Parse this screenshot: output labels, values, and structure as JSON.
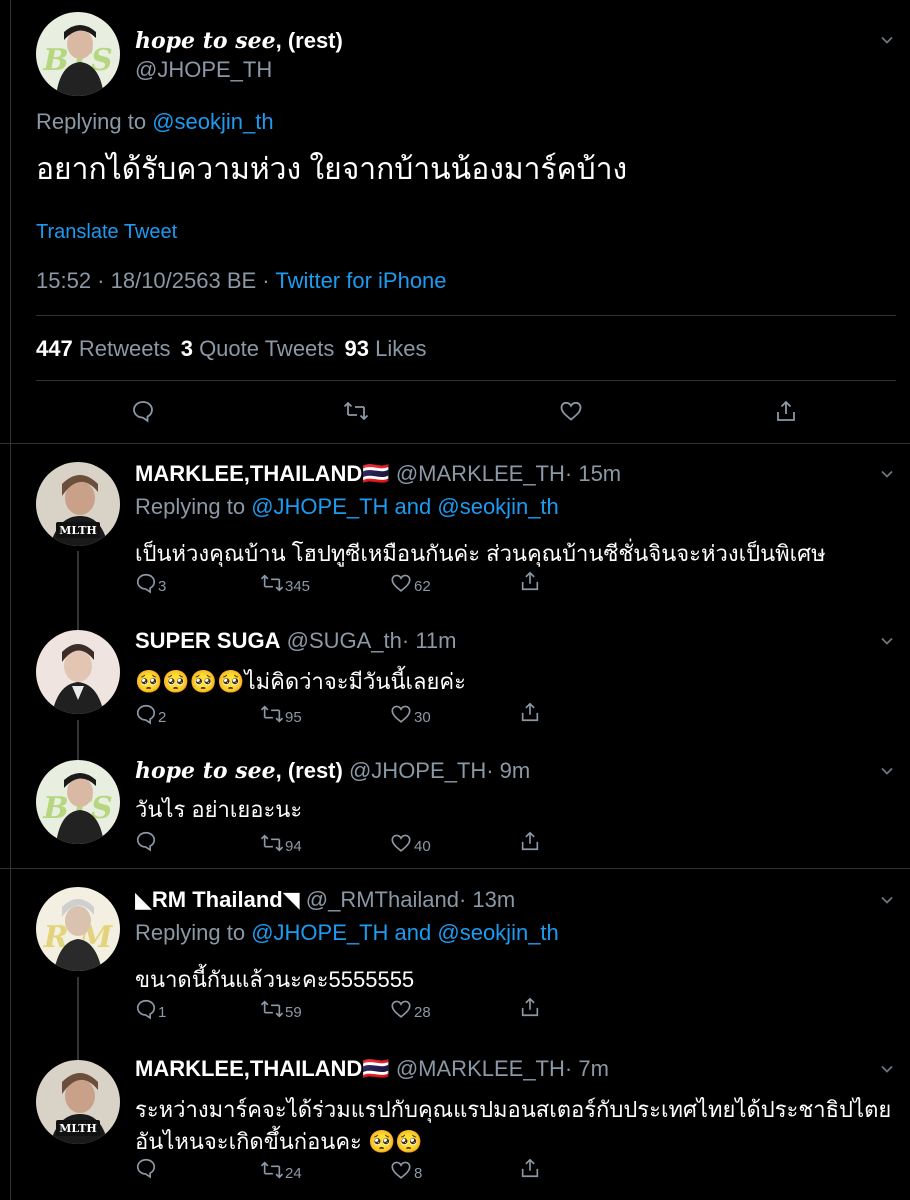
{
  "main": {
    "display_name": "hope to see",
    "display_name_rest": ", (rest)",
    "handle": "@JHOPE_TH",
    "replying_label": "Replying to",
    "replying_handle": "@seokjin_th",
    "text": "อยากได้รับความห่วง ใยจากบ้านน้องมาร์คบ้าง",
    "translate": "Translate Tweet",
    "timestamp": "15:52 · 18/10/2563 BE ·",
    "client": "Twitter for iPhone",
    "retweets_count": "447",
    "retweets_label": "Retweets",
    "quotes_count": "3",
    "quotes_label": "Quote Tweets",
    "likes_count": "93",
    "likes_label": "Likes"
  },
  "replies": [
    {
      "name": "MARKLEE,THAILAND🇹🇭",
      "handle": "@MARKLEE_TH",
      "time": "· 15m",
      "replying_label": "Replying to",
      "replying_to": "@JHOPE_TH and @seokjin_th",
      "text": "เป็นห่วงคุณบ้าน โฮปทูซีเหมือนกันค่ะ ส่วนคุณบ้านซีชั่นจินจะห่วงเป็นพิเศษ",
      "reply_count": "3",
      "retweet_count": "345",
      "like_count": "62"
    },
    {
      "name": "SUPER SUGA",
      "handle": "@SUGA_th",
      "time": "· 11m",
      "text": "🥺🥺🥺🥺ไม่คิดว่าจะมีวันนี้เลยค่ะ",
      "reply_count": "2",
      "retweet_count": "95",
      "like_count": "30"
    },
    {
      "name": "hope to see",
      "name_rest": ", (rest)",
      "handle": "@JHOPE_TH",
      "time": "· 9m",
      "text": "วันไร อย่าเยอะนะ",
      "reply_count": "",
      "retweet_count": "94",
      "like_count": "40"
    },
    {
      "name": "◣RM Thailand◥",
      "handle": "@_RMThailand",
      "time": "· 13m",
      "replying_label": "Replying to",
      "replying_to": "@JHOPE_TH and @seokjin_th",
      "text": "ขนาดนี้กันแล้วนะคะ5555555",
      "reply_count": "1",
      "retweet_count": "59",
      "like_count": "28"
    },
    {
      "name": "MARKLEE,THAILAND🇹🇭",
      "handle": "@MARKLEE_TH",
      "time": "· 7m",
      "text_line1": "ระหว่างมาร์คจะได้ร่วมแรปกับคุณแรปมอนสเตอร์กับประเทศไทยได้ประชาธิปไตย",
      "text_line2": "อันไหนจะเกิดขึ้นก่อนคะ 🥺🥺",
      "reply_count": "",
      "retweet_count": "24",
      "like_count": "8"
    }
  ],
  "avatar_marks": {
    "bts": "BTS",
    "mlth": "MLTH"
  },
  "colors": {
    "background": "#000000",
    "link_blue": "#1d9bf0",
    "secondary_gray": "#8b98a5",
    "divider": "#2f3336"
  },
  "icons": [
    "reply-icon",
    "retweet-icon",
    "like-icon",
    "share-icon",
    "chevron-down-icon"
  ]
}
